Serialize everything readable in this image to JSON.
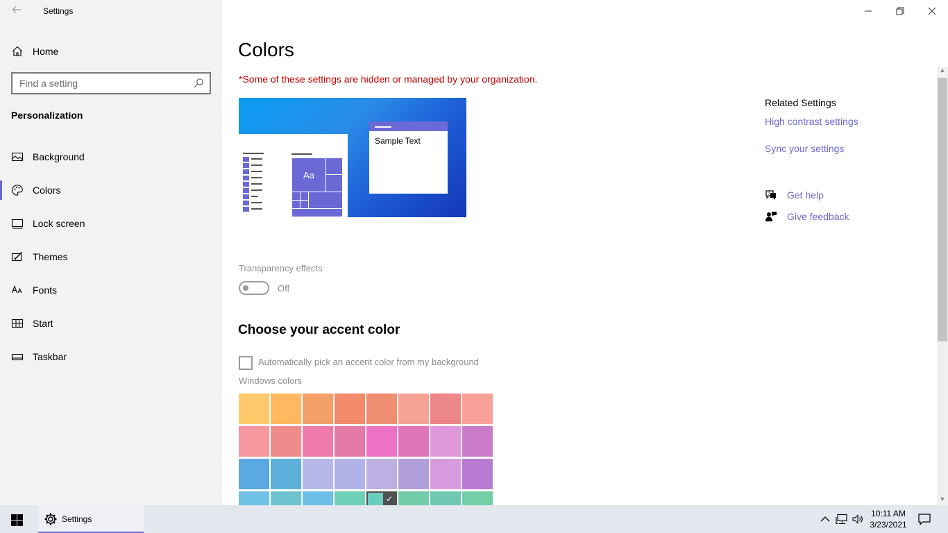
{
  "window": {
    "app_title": "Settings"
  },
  "sidebar": {
    "home_label": "Home",
    "search_placeholder": "Find a setting",
    "section_header": "Personalization",
    "items": [
      {
        "label": "Background",
        "icon": "picture-icon"
      },
      {
        "label": "Colors",
        "icon": "palette-icon",
        "active": true
      },
      {
        "label": "Lock screen",
        "icon": "lock-screen-icon"
      },
      {
        "label": "Themes",
        "icon": "brush-icon"
      },
      {
        "label": "Fonts",
        "icon": "font-icon"
      },
      {
        "label": "Start",
        "icon": "start-menu-icon"
      },
      {
        "label": "Taskbar",
        "icon": "taskbar-icon"
      }
    ]
  },
  "main": {
    "title": "Colors",
    "org_note": "*Some of these settings are hidden or managed by your organization.",
    "preview": {
      "tile_text": "Aa",
      "sample_text": "Sample Text"
    },
    "transparency": {
      "label": "Transparency effects",
      "state": "Off"
    },
    "accent": {
      "heading": "Choose your accent color",
      "auto_label": "Automatically pick an accent color from my background",
      "windows_colors_label": "Windows colors",
      "swatches": [
        [
          "#ffc96b",
          "#ffb860",
          "#f3a069",
          "#f38a6a",
          "#ef8e71",
          "#f4a395",
          "#ec8687",
          "#f7a199"
        ],
        [
          "#f5979e",
          "#ef8b8b",
          "#ee7bab",
          "#e47aa5",
          "#ee72c4",
          "#e074b8",
          "#e098dd",
          "#c97bca"
        ],
        [
          "#5aa9e2",
          "#5eb0dc",
          "#b7b8ea",
          "#b0b2e8",
          "#bcb0e2",
          "#b19fdc",
          "#d89be0",
          "#b77bd3"
        ],
        [
          "#6fc1e6",
          "#6fc3d0",
          "#6dbfe7",
          "#6fd0b8",
          "#69cdbf",
          "#72cda8",
          "#6fc9b2",
          "#72cfa8"
        ]
      ],
      "selected": "3-4"
    }
  },
  "related": {
    "title": "Related Settings",
    "links": [
      "High contrast settings",
      "Sync your settings"
    ],
    "help": [
      {
        "label": "Get help",
        "icon": "help-chat-icon"
      },
      {
        "label": "Give feedback",
        "icon": "feedback-icon"
      }
    ]
  },
  "taskbar": {
    "app_label": "Settings",
    "time": "10:11 AM",
    "date": "3/23/2021"
  },
  "colors": {
    "accent": "#6b69d6",
    "warning": "#c50500",
    "link": "#6b69d6"
  }
}
